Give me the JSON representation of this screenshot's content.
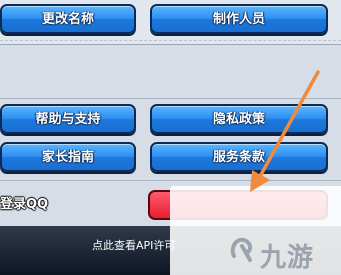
{
  "buttons": {
    "rename": "更改名称",
    "credits": "制作人员",
    "help": "帮助与支持",
    "privacy": "隐私政策",
    "parent_guide": "家长指南",
    "terms": "服务条款"
  },
  "qq_label": "登录QQ",
  "footer_link": "点此查看API许可",
  "watermark_text": "九游",
  "colors": {
    "button_blue": "#2d8ff0",
    "button_red": "#e61e33",
    "arrow": "#f08a3c",
    "panel": "#d6dde7"
  },
  "icons": {
    "arrow": "annotation-arrow-icon",
    "watermark": "jiuyou-logo-icon"
  }
}
